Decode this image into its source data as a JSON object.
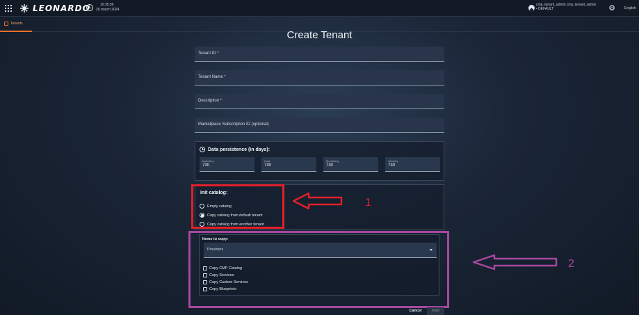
{
  "header": {
    "brand": "LEONARDO",
    "time": "10:35:36",
    "date": "26 march 2024",
    "user_line1": "cmp_tenant_admin cmp_tenant_admin",
    "user_line2": "• DEFAULT",
    "language": "English"
  },
  "tabs": [
    {
      "label": "Tenants",
      "active": true
    }
  ],
  "form": {
    "title": "Create Tenant",
    "fields": [
      {
        "label": "Tenant ID *"
      },
      {
        "label": "Tenant Name *"
      },
      {
        "label": "Description *"
      },
      {
        "label": "Marketplace Subscription ID (optional)"
      }
    ],
    "data_persistence": {
      "title": "Data persistence (in days):",
      "items": [
        {
          "label": "Inventory",
          "value": "730"
        },
        {
          "label": "Cost",
          "value": "730"
        },
        {
          "label": "Monitoring",
          "value": "730"
        },
        {
          "label": "Security",
          "value": "730"
        }
      ]
    },
    "init_catalog": {
      "title": "Init catalog:",
      "options": [
        {
          "label": "Empty catalog",
          "checked": false
        },
        {
          "label": "Copy catalog from default tenant",
          "checked": true
        },
        {
          "label": "Copy catalog from another tenant",
          "checked": false
        }
      ]
    },
    "items_to_copy": {
      "title": "Items to copy:",
      "select_value": "Providers",
      "checkboxes": [
        {
          "label": "Copy CMP Catalog",
          "checked": false
        },
        {
          "label": "Copy Services",
          "checked": false
        },
        {
          "label": "Copy Custom Services",
          "checked": false
        },
        {
          "label": "Copy Blueprints",
          "checked": false
        }
      ]
    },
    "buttons": {
      "cancel": "Cancel",
      "add": "Add"
    }
  },
  "annotations": [
    {
      "number": "1",
      "color": "#e0202a"
    },
    {
      "number": "2",
      "color": "#a648a0"
    }
  ],
  "colors": {
    "accent": "#e8702a",
    "highlight_1": "#e0202a",
    "highlight_2": "#a648a0"
  }
}
